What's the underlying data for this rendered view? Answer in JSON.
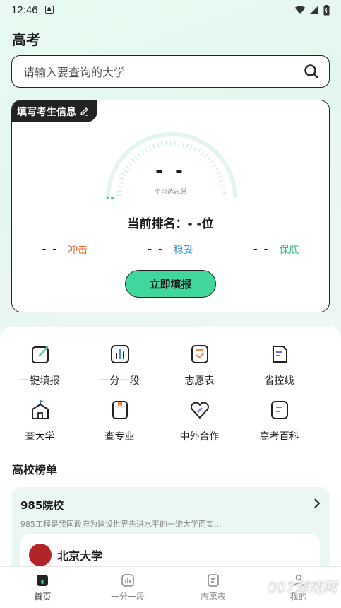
{
  "status_bar": {
    "time": "12:46",
    "badge": "A"
  },
  "page_title": "高考",
  "search": {
    "placeholder": "请输入要查询的大学"
  },
  "info_card": {
    "tag": "填写考生信息",
    "score": "- -",
    "score_sub": "个可选志愿",
    "rank": "当前排名：- -位",
    "categories": [
      {
        "value": "- -",
        "label": "冲击",
        "color": "#e5662a"
      },
      {
        "value": "- -",
        "label": "稳妥",
        "color": "#3a8fd8"
      },
      {
        "value": "- -",
        "label": "保底",
        "color": "#34b67a"
      }
    ],
    "button": "立即填报"
  },
  "grid": [
    {
      "label": "一键填报",
      "icon": "pencil-note-icon"
    },
    {
      "label": "一分一段",
      "icon": "bar-chart-icon"
    },
    {
      "label": "志愿表",
      "icon": "checklist-icon"
    },
    {
      "label": "省控线",
      "icon": "document-icon"
    },
    {
      "label": "查大学",
      "icon": "school-building-icon"
    },
    {
      "label": "查专业",
      "icon": "bookmark-book-icon"
    },
    {
      "label": "中外合作",
      "icon": "heart-handshake-icon"
    },
    {
      "label": "高考百科",
      "icon": "encyclopedia-icon"
    }
  ],
  "section_title": "高校榜单",
  "ranking": {
    "title": "985院校",
    "desc": "985工程是我国政府为建设世界先进水平的一流大学而实...",
    "first_school": "北京大学"
  },
  "tabs": [
    {
      "label": "首页",
      "active": true
    },
    {
      "label": "一分一段",
      "active": false
    },
    {
      "label": "志愿表",
      "active": false
    },
    {
      "label": "我的",
      "active": false
    }
  ],
  "watermark": "007游戏网",
  "colors": {
    "accent": "#3fd79b",
    "dark": "#222222"
  }
}
